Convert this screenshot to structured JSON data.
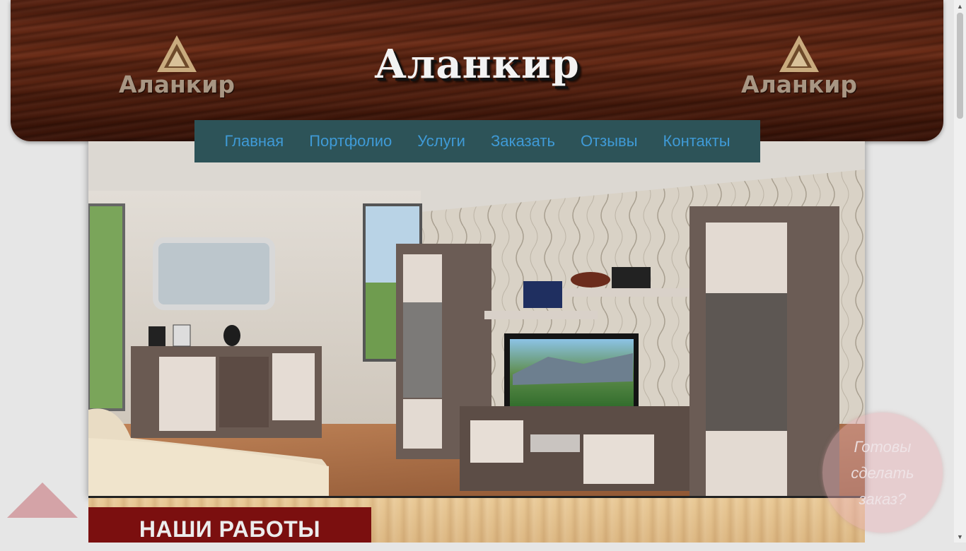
{
  "header": {
    "title": "Аланкир",
    "logo_text": "Аланкир"
  },
  "nav": {
    "items": [
      "Главная",
      "Портфолио",
      "Услуги",
      "Заказать",
      "Отзывы",
      "Контакты"
    ]
  },
  "section": {
    "works_title": "НАШИ РАБОТЫ"
  },
  "order": {
    "text": "Готовы сделать заказ?"
  },
  "colors": {
    "nav_bg": "#2d5358",
    "nav_link": "#3f9ad6",
    "works_bg": "#7b0f0f"
  }
}
